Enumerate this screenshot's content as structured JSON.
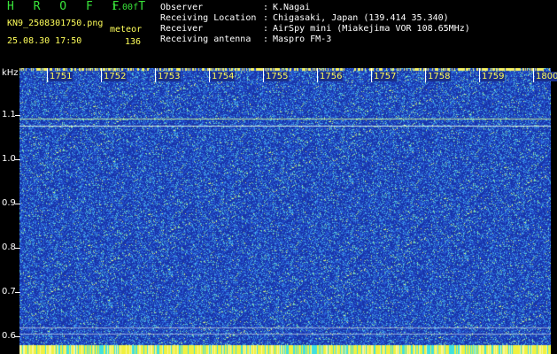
{
  "header": {
    "app_title": "H R O F F T",
    "version": "1.00f",
    "filename": "KN9_2508301750.png",
    "datetime": "25.08.30 17:50",
    "meteor_label": "meteor",
    "meteor_count": "136"
  },
  "info": [
    {
      "key": "Observer",
      "sep": ":",
      "value": "K.Nagai"
    },
    {
      "key": "Receiving Location",
      "sep": ":",
      "value": "Chigasaki, Japan (139.414 35.340)"
    },
    {
      "key": "Receiver",
      "sep": ":",
      "value": "AirSpy mini (Miakejima VOR 108.65MHz)"
    },
    {
      "key": "Receiving antenna",
      "sep": ":",
      "value": "Maspro FM-3"
    }
  ],
  "axis": {
    "y_unit": "kHz",
    "y_ticks": [
      "1.1",
      "1.0",
      "0.9",
      "0.8",
      "0.7",
      "0.6"
    ],
    "x_ticks": [
      "1751",
      "1752",
      "1753",
      "1754",
      "1755",
      "1756",
      "1757",
      "1758",
      "1759",
      "1800"
    ]
  },
  "colors": {
    "background": "#000000",
    "spectrogram_base": "#1d3fbc",
    "title_green": "#39e43a",
    "tick_yellow": "#ffff5a"
  }
}
